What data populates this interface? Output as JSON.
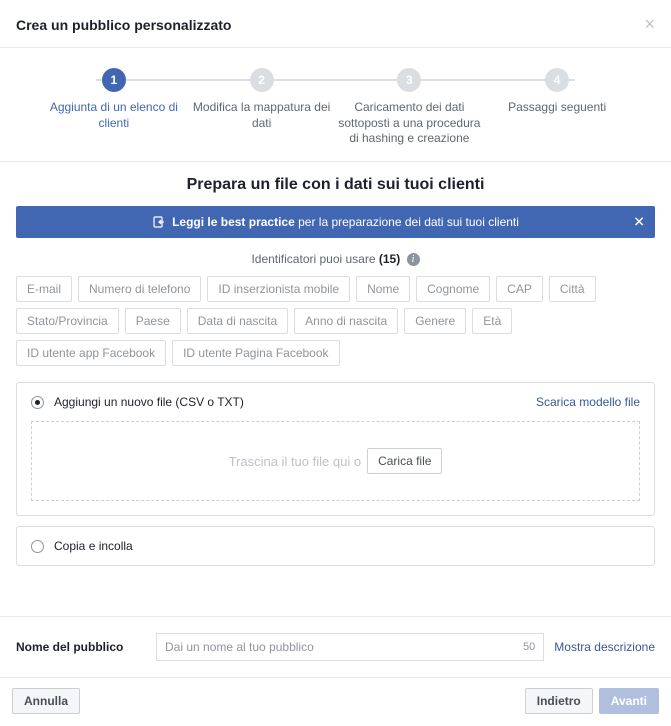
{
  "header": {
    "title": "Crea un pubblico personalizzato"
  },
  "steps": [
    {
      "num": "1",
      "label": "Aggiunta di un elenco di clienti"
    },
    {
      "num": "2",
      "label": "Modifica la mappatura dei dati"
    },
    {
      "num": "3",
      "label": "Caricamento dei dati sottoposti a una procedura di hashing e creazione"
    },
    {
      "num": "4",
      "label": "Passaggi seguenti"
    }
  ],
  "subtitle": "Prepara un file con i dati sui tuoi clienti",
  "banner": {
    "bold": "Leggi le best practice",
    "rest": " per la preparazione dei dati sui tuoi clienti"
  },
  "identifiers": {
    "label": "Identificatori puoi usare ",
    "count": "(15)"
  },
  "tags": [
    "E-mail",
    "Numero di telefono",
    "ID inserzionista mobile",
    "Nome",
    "Cognome",
    "CAP",
    "Città",
    "Stato/Provincia",
    "Paese",
    "Data di nascita",
    "Anno di nascita",
    "Genere",
    "Età",
    "ID utente app Facebook",
    "ID utente Pagina Facebook"
  ],
  "option1": {
    "label": "Aggiungi un nuovo file (CSV o TXT)",
    "download": "Scarica modello file",
    "dropText": "Trascina il tuo file qui o",
    "uploadBtn": "Carica file"
  },
  "option2": {
    "label": "Copia e incolla"
  },
  "nameRow": {
    "label": "Nome del pubblico",
    "placeholder": "Dai un nome al tuo pubblico",
    "count": "50",
    "showDesc": "Mostra descrizione"
  },
  "footer": {
    "cancel": "Annulla",
    "back": "Indietro",
    "next": "Avanti"
  }
}
